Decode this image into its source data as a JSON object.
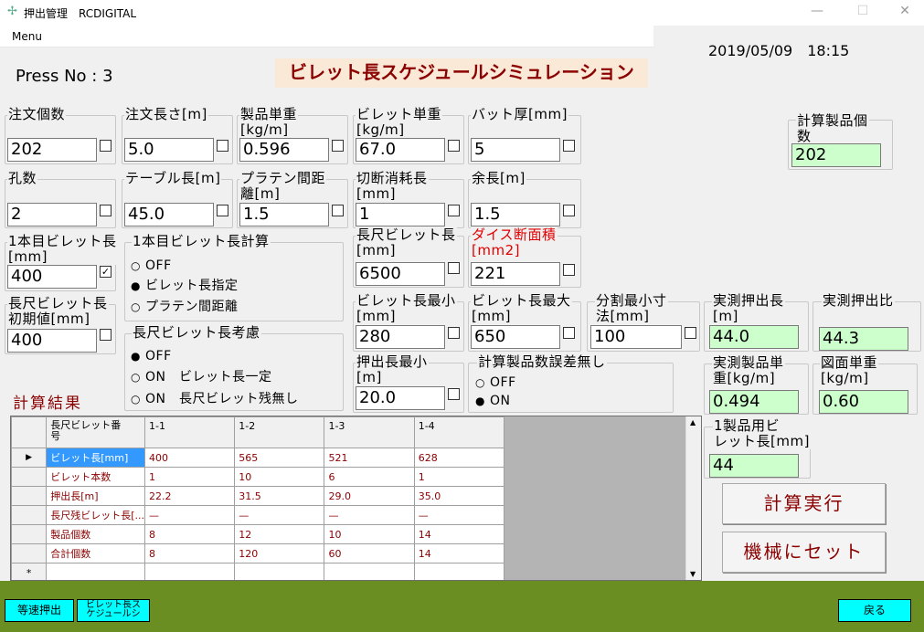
{
  "window": {
    "title": "押出管理　RCDIGITAL",
    "minimize": "—",
    "maximize": "☐",
    "close": "✕"
  },
  "menu": {
    "label": "Menu"
  },
  "datetime": "2019/05/09　18:15",
  "press": "Press No : 3",
  "page_title": "ビレット長スケジュールシミュレーション",
  "fields": {
    "order_count": {
      "label": "注文個数",
      "value": "202"
    },
    "order_length": {
      "label": "注文長さ[m]",
      "value": "5.0"
    },
    "product_unit_weight": {
      "label": "製品単重\n[kg/m]",
      "value": "0.596"
    },
    "billet_unit_weight": {
      "label": "ビレット単重\n[kg/m]",
      "value": "67.0"
    },
    "butt_thickness": {
      "label": "バット厚[mm]",
      "value": "5"
    },
    "hole_count": {
      "label": "孔数",
      "value": "2"
    },
    "table_length": {
      "label": "テーブル長[m]",
      "value": "45.0"
    },
    "platen_distance": {
      "label": "プラテン間距\n離[m]",
      "value": "1.5"
    },
    "cut_loss_length": {
      "label": "切断消耗長\n[mm]",
      "value": "1"
    },
    "margin_length": {
      "label": "余長[m]",
      "value": "1.5"
    },
    "first_billet_length": {
      "label": "1本目ビレット長\n[mm]",
      "value": "400",
      "checked": "✓"
    },
    "long_billet_length": {
      "label": "長尺ビレット長\n[mm]",
      "value": "6500"
    },
    "die_area": {
      "label": "ダイス断面積\n[mm2]",
      "value": "221"
    },
    "long_billet_initial": {
      "label": "長尺ビレット長\n初期値[mm]",
      "value": "400"
    },
    "billet_min": {
      "label": "ビレット長最小\n[mm]",
      "value": "280"
    },
    "billet_max": {
      "label": "ビレット長最大\n[mm]",
      "value": "650"
    },
    "split_min": {
      "label": "分割最小寸\n法[mm]",
      "value": "100"
    },
    "extrude_min": {
      "label": "押出長最小\n[m]",
      "value": "20.0"
    },
    "calc_product_count": {
      "label": "計算製品個\n数",
      "value": "202"
    },
    "measured_extrude_length": {
      "label": "実測押出長\n[m]",
      "value": "44.0"
    },
    "measured_extrude_ratio": {
      "label": "実測押出比",
      "value": "44.3"
    },
    "measured_product_weight": {
      "label": "実測製品単\n重[kg/m]",
      "value": "0.494"
    },
    "drawing_unit_weight": {
      "label": "図面単重\n[kg/m]",
      "value": "0.60"
    },
    "billet_per_product": {
      "label": "1製品用ビ\nレット長[mm]",
      "value": "44"
    }
  },
  "first_billet_calc": {
    "label": "1本目ビレット長計算",
    "options": [
      "OFF",
      "ビレット長指定",
      "プラテン間距離"
    ],
    "selected_mark": "●",
    "unselected_mark": "○"
  },
  "long_billet_consider": {
    "label": "長尺ビレット長考慮",
    "options": [
      "OFF",
      "ON　ビレット長一定",
      "ON　長尺ビレット残無し"
    ]
  },
  "error_free": {
    "label": "計算製品数誤差無し",
    "options": [
      "OFF",
      "ON"
    ]
  },
  "result_label": "計算結果",
  "table": {
    "header": [
      "長尺ビレット番\n号",
      "1-1",
      "1-2",
      "1-3",
      "1-4"
    ],
    "rows": [
      {
        "name": "ビレット長[mm]",
        "cells": [
          "400",
          "565",
          "521",
          "628"
        ]
      },
      {
        "name": "ビレット本数",
        "cells": [
          "1",
          "10",
          "6",
          "1"
        ]
      },
      {
        "name": "押出長[m]",
        "cells": [
          "22.2",
          "31.5",
          "29.0",
          "35.0"
        ]
      },
      {
        "name": "長尺残ビレット長[...",
        "cells": [
          "—",
          "—",
          "—",
          "—"
        ]
      },
      {
        "name": "製品個数",
        "cells": [
          "8",
          "12",
          "10",
          "14"
        ]
      },
      {
        "name": "合計個数",
        "cells": [
          "8",
          "120",
          "60",
          "14"
        ]
      }
    ],
    "current_row_marker": "▶",
    "new_row_marker": "*"
  },
  "buttons": {
    "calculate": "計算実行",
    "set_machine": "機械にセット",
    "constant_speed": "等速押出",
    "billet_schedule": "ビレット長ス\nケジュールシ",
    "back": "戻る"
  }
}
